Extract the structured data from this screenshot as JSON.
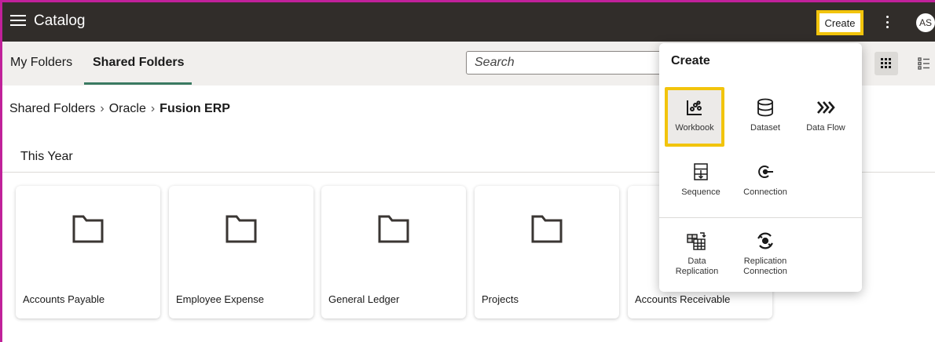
{
  "header": {
    "title": "Catalog",
    "create_label": "Create",
    "avatar_initials": "AS"
  },
  "tabs": [
    {
      "label": "My Folders",
      "active": false
    },
    {
      "label": "Shared Folders",
      "active": true
    }
  ],
  "search": {
    "placeholder": "Search"
  },
  "breadcrumb": [
    "Shared Folders",
    "Oracle",
    "Fusion ERP"
  ],
  "section": {
    "title": "This Year"
  },
  "folders": [
    {
      "label": "Accounts Payable",
      "icon": "folder-icon"
    },
    {
      "label": "Employee Expense",
      "icon": "folder-icon"
    },
    {
      "label": "General Ledger",
      "icon": "folder-icon"
    },
    {
      "label": "Projects",
      "icon": "folder-icon"
    },
    {
      "label": "Accounts Receivable",
      "icon": "folder-icon"
    }
  ],
  "create_menu": {
    "title": "Create",
    "items": [
      {
        "label": "Workbook",
        "icon": "workbook-icon",
        "highlighted": true
      },
      {
        "label": "Dataset",
        "icon": "dataset-icon"
      },
      {
        "label": "Data Flow",
        "icon": "data-flow-icon"
      },
      {
        "label": "Sequence",
        "icon": "sequence-icon"
      },
      {
        "label": "Connection",
        "icon": "connection-icon"
      },
      {
        "label": "Data\nReplication",
        "icon": "data-replication-icon"
      },
      {
        "label": "Replication\nConnection",
        "icon": "replication-connection-icon"
      }
    ]
  },
  "colors": {
    "topbar": "#312d2a",
    "highlight": "#f2c40c",
    "tab_underline": "#3a7a62",
    "frame": "#c0219a"
  }
}
